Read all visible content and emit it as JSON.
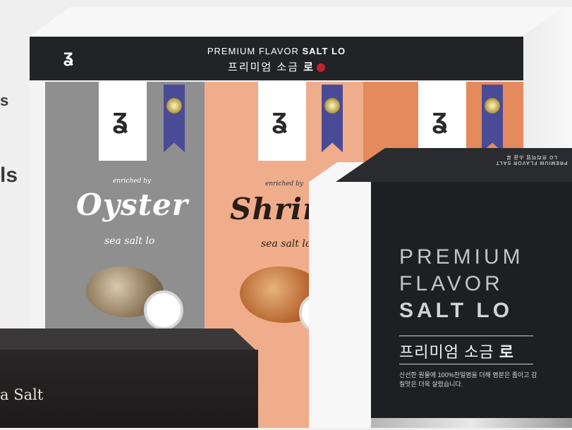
{
  "left_edge_text": {
    "letter1": "s",
    "letter2": "ls"
  },
  "back_box": {
    "band_line1_prefix": "PREMIUM FLAVOR",
    "band_line1_bold": "SALT LO",
    "band_line2": "프리미엄 소금",
    "band_line2_bold": "로"
  },
  "products": [
    {
      "name": "Oyster",
      "sub": "sea salt lo",
      "small": "enriched by",
      "color": "#8f8f90"
    },
    {
      "name": "Shrim",
      "sub": "sea salt lo",
      "small": "enriched by",
      "color": "#f0ad8b"
    },
    {
      "name": "",
      "sub": "",
      "small": "",
      "color": "#e58a5d"
    }
  ],
  "front_left_box": {
    "text": "a Salt"
  },
  "front_right_box": {
    "line1": "PREMIUM",
    "line2": "FLAVOR",
    "line3": "SALT LO",
    "ko_title": "프리미엄 소금",
    "ko_title_bold": "로",
    "description": "신선한 원물에 100%천일염을 더해 염분은 줄이고 감칠맛은 더욱 살렸습니다.",
    "top_text": "PREMIUM FLAVOR SALT LO 프리미엄 소금 로"
  }
}
